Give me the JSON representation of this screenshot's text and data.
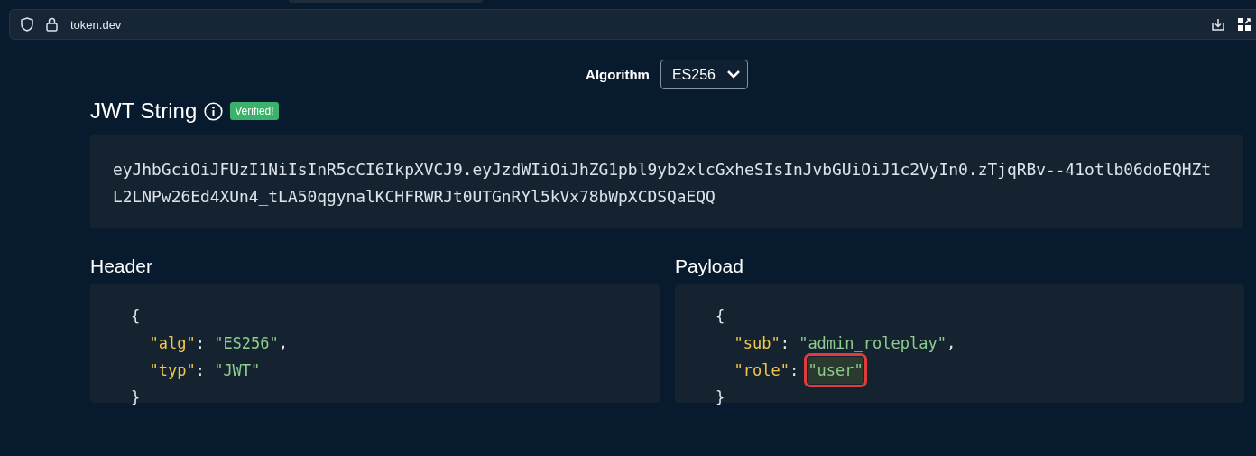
{
  "browser": {
    "url": "token.dev"
  },
  "algorithm": {
    "label": "Algorithm",
    "value": "ES256"
  },
  "jwt": {
    "title": "JWT String",
    "badge": "Verified!",
    "verified": true,
    "token": "eyJhbGciOiJFUzI1NiIsInR5cCI6IkpXVCJ9.eyJzdWIiOiJhZG1pbl9yb2xlcGxheSIsInJvbGUiOiJ1c2VyIn0.zTjqRBv--41otlb06doEQHZtL2LNPw26Ed4XUn4_tLA50qgynalKCHFRWRJt0UTGnRYl5kVx78bWpXCDSQaEQQ"
  },
  "panels": [
    {
      "title": "Header",
      "open": "{",
      "close": "}",
      "entries": [
        {
          "key": "\"alg\"",
          "separator": ":",
          "value": "\"ES256\"",
          "trailing": ",",
          "highlighted": false
        },
        {
          "key": "\"typ\"",
          "separator": ":",
          "value": "\"JWT\"",
          "highlighted": false
        }
      ]
    },
    {
      "title": "Payload",
      "open": "{",
      "close": "}",
      "entries": [
        {
          "key": "\"sub\"",
          "separator": ":",
          "value": "\"admin_roleplay\"",
          "trailing": ",",
          "highlighted": false
        },
        {
          "key": "\"role\"",
          "separator": ":",
          "value": "\"user\"",
          "highlighted": true
        }
      ]
    }
  ]
}
